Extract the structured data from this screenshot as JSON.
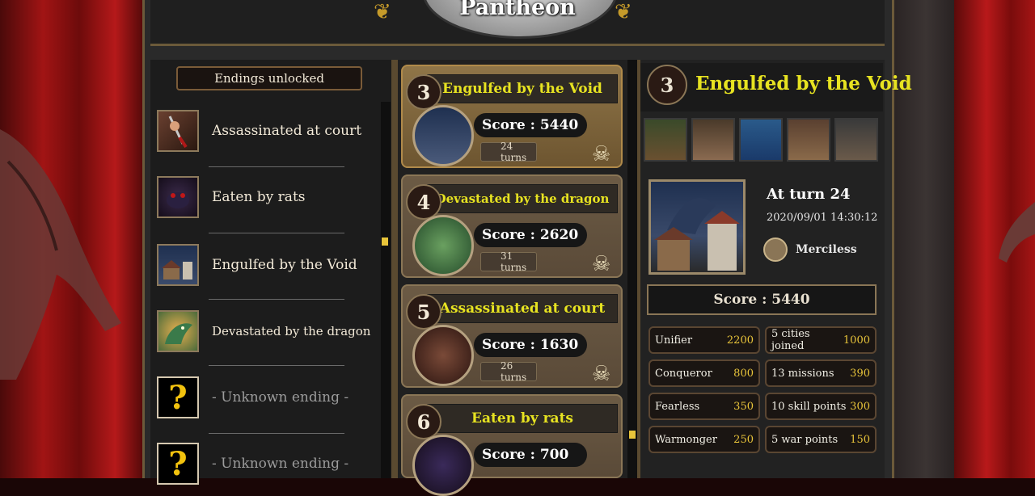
{
  "title": "Pantheon",
  "endings_panel": {
    "header": "Endings unlocked",
    "items": [
      {
        "label": "Assassinated at court",
        "icon": "dagger-hand-icon",
        "known": true
      },
      {
        "label": "Eaten by rats",
        "icon": "rat-icon",
        "known": true
      },
      {
        "label": "Engulfed by the Void",
        "icon": "void-town-icon",
        "known": true
      },
      {
        "label": "Devastated by the dragon",
        "icon": "dragon-icon",
        "known": true
      },
      {
        "label": "- Unknown ending -",
        "icon": "question-icon",
        "known": false,
        "glyph": "?"
      },
      {
        "label": "- Unknown ending -",
        "icon": "question-icon",
        "known": false,
        "glyph": "?"
      }
    ]
  },
  "runs": [
    {
      "rank": "3",
      "title": "Engulfed by the Void",
      "score": "Score : 5440",
      "turns": "24 turns",
      "active": true
    },
    {
      "rank": "4",
      "title": "Devastated by the dragon",
      "score": "Score : 2620",
      "turns": "31 turns",
      "active": false
    },
    {
      "rank": "5",
      "title": "Assassinated at court",
      "score": "Score : 1630",
      "turns": "26 turns",
      "active": false
    },
    {
      "rank": "6",
      "title": "Eaten by rats",
      "score": "Score : 700",
      "turns": "",
      "active": false
    }
  ],
  "detail": {
    "rank": "3",
    "title": "Engulfed by the Void",
    "at_turn": "At turn 24",
    "date": "2020/09/01 14:30:12",
    "difficulty": "Merciless",
    "score": "Score : 5440",
    "stats": [
      {
        "name": "Unifier",
        "value": "2200"
      },
      {
        "name": "5 cities joined",
        "value": "1000"
      },
      {
        "name": "Conqueror",
        "value": "800"
      },
      {
        "name": "13 missions",
        "value": "390"
      },
      {
        "name": "Fearless",
        "value": "350"
      },
      {
        "name": "10 skill points",
        "value": "300"
      },
      {
        "name": "Warmonger",
        "value": "250"
      },
      {
        "name": "5 war points",
        "value": "150"
      }
    ]
  },
  "colors": {
    "accent_yellow": "#e7e321",
    "frame_gold": "#8a7656",
    "curtain_red": "#a11414"
  }
}
